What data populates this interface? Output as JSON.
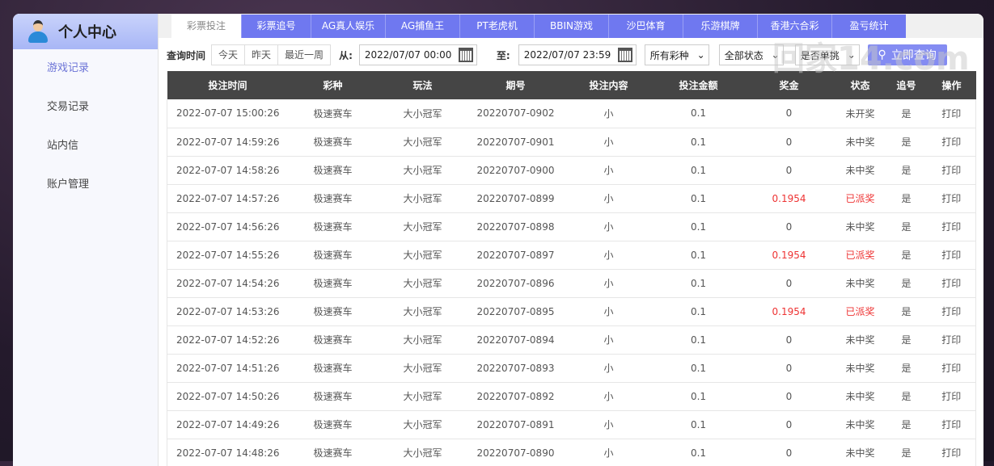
{
  "sidebar": {
    "title": "个人中心",
    "items": [
      "游戏记录",
      "交易记录",
      "站内信",
      "账户管理"
    ]
  },
  "tabs": [
    "彩票投注",
    "彩票追号",
    "AG真人娱乐",
    "AG捕鱼王",
    "PT老虎机",
    "BBIN游戏",
    "沙巴体育",
    "乐游棋牌",
    "香港六合彩",
    "盈亏统计"
  ],
  "filters": {
    "label": "查询时间",
    "quick": [
      "今天",
      "昨天",
      "最近一周"
    ],
    "from_label": "从:",
    "from": "2022/07/07 00:00",
    "to_label": "至:",
    "to": "2022/07/07 23:59",
    "lottery": "所有彩种",
    "status": "全部状态",
    "single": "是否单挑",
    "search": "立即查询"
  },
  "table": {
    "headers": [
      "投注时间",
      "彩种",
      "玩法",
      "期号",
      "投注内容",
      "投注金额",
      "奖金",
      "状态",
      "追号",
      "操作"
    ],
    "rows": [
      [
        "2022-07-07 15:00:26",
        "极速赛车",
        "大小冠军",
        "20220707-0902",
        "小",
        "0.1",
        "0",
        "未开奖",
        "是",
        "打印"
      ],
      [
        "2022-07-07 14:59:26",
        "极速赛车",
        "大小冠军",
        "20220707-0901",
        "小",
        "0.1",
        "0",
        "未中奖",
        "是",
        "打印"
      ],
      [
        "2022-07-07 14:58:26",
        "极速赛车",
        "大小冠军",
        "20220707-0900",
        "小",
        "0.1",
        "0",
        "未中奖",
        "是",
        "打印"
      ],
      [
        "2022-07-07 14:57:26",
        "极速赛车",
        "大小冠军",
        "20220707-0899",
        "小",
        "0.1",
        "0.1954",
        "已派奖",
        "是",
        "打印"
      ],
      [
        "2022-07-07 14:56:26",
        "极速赛车",
        "大小冠军",
        "20220707-0898",
        "小",
        "0.1",
        "0",
        "未中奖",
        "是",
        "打印"
      ],
      [
        "2022-07-07 14:55:26",
        "极速赛车",
        "大小冠军",
        "20220707-0897",
        "小",
        "0.1",
        "0.1954",
        "已派奖",
        "是",
        "打印"
      ],
      [
        "2022-07-07 14:54:26",
        "极速赛车",
        "大小冠军",
        "20220707-0896",
        "小",
        "0.1",
        "0",
        "未中奖",
        "是",
        "打印"
      ],
      [
        "2022-07-07 14:53:26",
        "极速赛车",
        "大小冠军",
        "20220707-0895",
        "小",
        "0.1",
        "0.1954",
        "已派奖",
        "是",
        "打印"
      ],
      [
        "2022-07-07 14:52:26",
        "极速赛车",
        "大小冠军",
        "20220707-0894",
        "小",
        "0.1",
        "0",
        "未中奖",
        "是",
        "打印"
      ],
      [
        "2022-07-07 14:51:26",
        "极速赛车",
        "大小冠军",
        "20220707-0893",
        "小",
        "0.1",
        "0",
        "未中奖",
        "是",
        "打印"
      ],
      [
        "2022-07-07 14:50:26",
        "极速赛车",
        "大小冠军",
        "20220707-0892",
        "小",
        "0.1",
        "0",
        "未中奖",
        "是",
        "打印"
      ],
      [
        "2022-07-07 14:49:26",
        "极速赛车",
        "大小冠军",
        "20220707-0891",
        "小",
        "0.1",
        "0",
        "未中奖",
        "是",
        "打印"
      ],
      [
        "2022-07-07 14:48:26",
        "极速赛车",
        "大小冠军",
        "20220707-0890",
        "小",
        "0.1",
        "0",
        "未中奖",
        "是",
        "打印"
      ]
    ]
  },
  "colors": {
    "accent": "#6f78f0",
    "win": "#ee3333"
  },
  "watermark": "回家14.com"
}
